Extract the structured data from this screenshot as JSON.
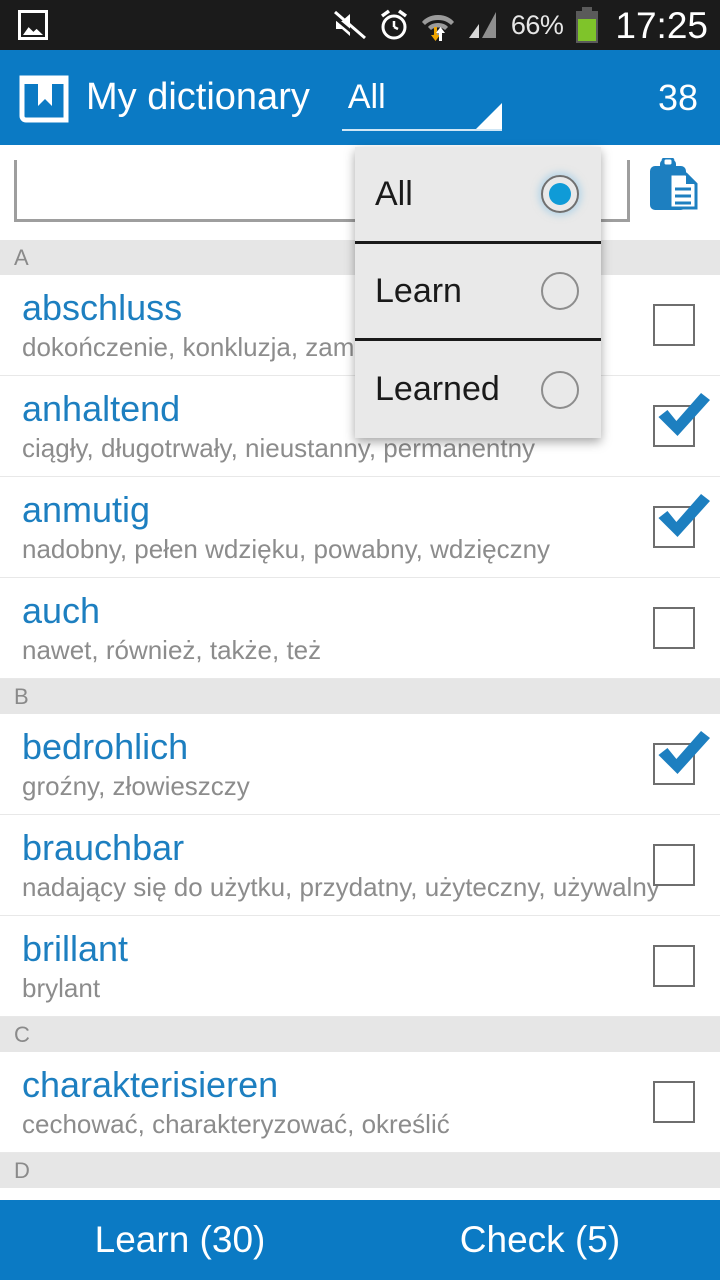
{
  "status_bar": {
    "gallery_icon": "gallery-icon",
    "icons": [
      "mute-icon",
      "alarm-icon",
      "wifi-transfer-icon",
      "signal-icon"
    ],
    "battery_percent": "66%",
    "battery_icon": "battery-icon",
    "time": "17:25",
    "background": "#1b1b1b"
  },
  "action_bar": {
    "app_icon": "book-bookmark-icon",
    "title": "My dictionary",
    "spinner_value": "All",
    "spinner_icon": "dropdown-triangle-icon",
    "count": "38",
    "background": "#0b7ac4"
  },
  "search": {
    "value": "",
    "placeholder": "",
    "clipboard_icon": "clipboard-icon"
  },
  "dropdown": {
    "visible": true,
    "options": [
      {
        "label": "All",
        "selected": true
      },
      {
        "label": "Learn",
        "selected": false
      },
      {
        "label": "Learned",
        "selected": false
      }
    ]
  },
  "list": {
    "sections": [
      {
        "letter": "A",
        "entries": [
          {
            "term": "abschluss",
            "definition": "dokończenie, konkluzja, zamknięcie",
            "checked": false
          },
          {
            "term": "anhaltend",
            "definition": "ciągły, długotrwały, nieustanny, permanentny",
            "checked": true
          },
          {
            "term": "anmutig",
            "definition": "nadobny, pełen wdzięku, powabny, wdzięczny",
            "checked": true
          },
          {
            "term": "auch",
            "definition": "nawet, również, także, też",
            "checked": false
          }
        ]
      },
      {
        "letter": "B",
        "entries": [
          {
            "term": "bedrohlich",
            "definition": "groźny, złowieszczy",
            "checked": true
          },
          {
            "term": "brauchbar",
            "definition": "nadający się do użytku, przydatny, użyteczny, używalny",
            "checked": false
          },
          {
            "term": "brillant",
            "definition": "brylant",
            "checked": false
          }
        ]
      },
      {
        "letter": "C",
        "entries": [
          {
            "term": "charakterisieren",
            "definition": "cechować, charakteryzować, określić",
            "checked": false
          }
        ]
      },
      {
        "letter": "D",
        "entries": []
      }
    ]
  },
  "bottom_bar": {
    "learn_label": "Learn (30)",
    "check_label": "Check (5)",
    "background": "#0b7ac4"
  },
  "colors": {
    "accent": "#0b7ac4",
    "term": "#1d7fc0",
    "definition": "#8c8c8c",
    "section_band": "#e6e6e6"
  }
}
